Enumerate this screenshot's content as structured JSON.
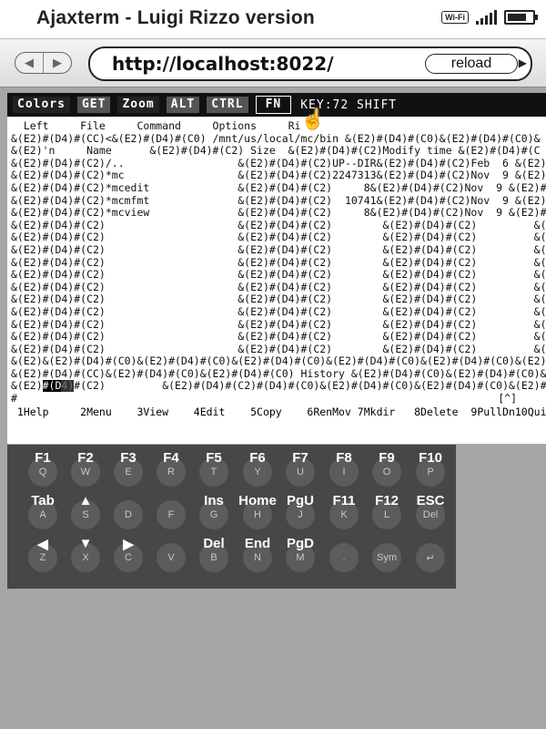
{
  "app_title": "Ajaxterm - Luigi Rizzo version",
  "status": {
    "wifi_label": "Wi-Fi",
    "battery_level": 0.85
  },
  "browser": {
    "url": "http://localhost:8022/",
    "reload_label": "reload"
  },
  "toolbar": {
    "colors": "Colors",
    "get": "GET",
    "zoom": "Zoom",
    "alt": "ALT",
    "ctrl": "CTRL",
    "fn": "FN",
    "key_info": "KEY:72 SHIFT"
  },
  "screen_lines": [
    "  Left     File     Command     Options     Ri",
    "&(E2)#(D4)#(CC)<&(E2)#(D4)#(C0) /mnt/us/local/mc/bin &(E2)#(D4)#(C0)&(E2)#(D4)#(C0)&",
    "&(E2)'n     Name      &(E2)#(D4)#(C2) Size  &(E2)#(D4)#(C2)Modify time &(E2)#(D4)#(C",
    "&(E2)#(D4)#(C2)/..                  &(E2)#(D4)#(C2)UP--DIR&(E2)#(D4)#(C2)Feb  6 &(E2)#(D",
    "&(E2)#(D4)#(C2)*mc                  &(E2)#(D4)#(C2)2247313&(E2)#(D4)#(C2)Nov  9 &(E2)#(D",
    "&(E2)#(D4)#(C2)*mcedit              &(E2)#(D4)#(C2)     8&(E2)#(D4)#(C2)Nov  9 &(E2)#(D",
    "&(E2)#(D4)#(C2)*mcmfmt              &(E2)#(D4)#(C2)  10741&(E2)#(D4)#(C2)Nov  9 &(E2)#(D",
    "&(E2)#(D4)#(C2)*mcview              &(E2)#(D4)#(C2)     8&(E2)#(D4)#(C2)Nov  9 &(E2)#(D",
    "&(E2)#(D4)#(C2)                     &(E2)#(D4)#(C2)        &(E2)#(D4)#(C2)         &(E2)#(D",
    "&(E2)#(D4)#(C2)                     &(E2)#(D4)#(C2)        &(E2)#(D4)#(C2)         &(E2)#(D",
    "&(E2)#(D4)#(C2)                     &(E2)#(D4)#(C2)        &(E2)#(D4)#(C2)         &(E2)#(D",
    "&(E2)#(D4)#(C2)                     &(E2)#(D4)#(C2)        &(E2)#(D4)#(C2)         &(E2)#(D",
    "&(E2)#(D4)#(C2)                     &(E2)#(D4)#(C2)        &(E2)#(D4)#(C2)         &(E2)#(D",
    "&(E2)#(D4)#(C2)                     &(E2)#(D4)#(C2)        &(E2)#(D4)#(C2)         &(E2)#(D",
    "&(E2)#(D4)#(C2)                     &(E2)#(D4)#(C2)        &(E2)#(D4)#(C2)         &(E2)#(D",
    "&(E2)#(D4)#(C2)                     &(E2)#(D4)#(C2)        &(E2)#(D4)#(C2)         &(E2)#(D",
    "&(E2)#(D4)#(C2)                     &(E2)#(D4)#(C2)        &(E2)#(D4)#(C2)         &(E2)#(D",
    "&(E2)#(D4)#(C2)                     &(E2)#(D4)#(C2)        &(E2)#(D4)#(C2)         &(E2)#(D",
    "&(E2)#(D4)#(C2)                     &(E2)#(D4)#(C2)        &(E2)#(D4)#(C2)         &(E2)#(D",
    "&(E2)&(E2)#(D4)#(C0)&(E2)#(D4)#(C0)&(E2)#(D4)#(C0)&(E2)#(D4)#(C0)&(E2)#(D4)#(C0)&(E2)",
    "&(E2)#(D4)#(CC)&(E2)#(D4)#(C0)&(E2)#(D4)#(C0) History &(E2)#(D4)#(C0)&(E2)#(D4)#(C0)&"
  ],
  "cursor_line": {
    "prefix": "&(E2)",
    "highlight_a": "#(D",
    "highlight_b": "4)",
    "suffix": "#(C2)         &(E2)#(D4)#(C2)#(D4)#(C0)&(E2)#(D4)#(C0)&(E2)#(D4)#(C0)&(E2)#(D4)#(C0)&"
  },
  "prompt_line": {
    "prompt": "#",
    "right": "[^]"
  },
  "fkey_bar": " 1Help     2Menu    3View    4Edit    5Copy    6RenMov 7Mkdir   8Delete  9PullDn10Quit",
  "keyboard": {
    "rows": [
      [
        {
          "main": "F1",
          "sub": "Q"
        },
        {
          "main": "F2",
          "sub": "W"
        },
        {
          "main": "F3",
          "sub": "E"
        },
        {
          "main": "F4",
          "sub": "R"
        },
        {
          "main": "F5",
          "sub": "T"
        },
        {
          "main": "F6",
          "sub": "Y"
        },
        {
          "main": "F7",
          "sub": "U"
        },
        {
          "main": "F8",
          "sub": "I"
        },
        {
          "main": "F9",
          "sub": "O"
        },
        {
          "main": "F10",
          "sub": "P"
        }
      ],
      [
        {
          "main": "Tab",
          "sub": "A"
        },
        {
          "main": "▲",
          "sub": "S"
        },
        {
          "main": "",
          "sub": "D"
        },
        {
          "main": "",
          "sub": "F"
        },
        {
          "main": "Ins",
          "sub": "G"
        },
        {
          "main": "Home",
          "sub": "H"
        },
        {
          "main": "PgU",
          "sub": "J"
        },
        {
          "main": "F11",
          "sub": "K"
        },
        {
          "main": "F12",
          "sub": "L"
        },
        {
          "main": "ESC",
          "sub": "Del"
        }
      ],
      [
        {
          "main": "◀",
          "sub": "Z"
        },
        {
          "main": "▼",
          "sub": "X"
        },
        {
          "main": "▶",
          "sub": "C"
        },
        {
          "main": "",
          "sub": "V"
        },
        {
          "main": "Del",
          "sub": "B"
        },
        {
          "main": "End",
          "sub": "N"
        },
        {
          "main": "PgD",
          "sub": "M"
        },
        {
          "main": "",
          "sub": "."
        },
        {
          "main": "",
          "sub": "Sym"
        },
        {
          "main": "",
          "sub": "↵"
        }
      ]
    ]
  }
}
